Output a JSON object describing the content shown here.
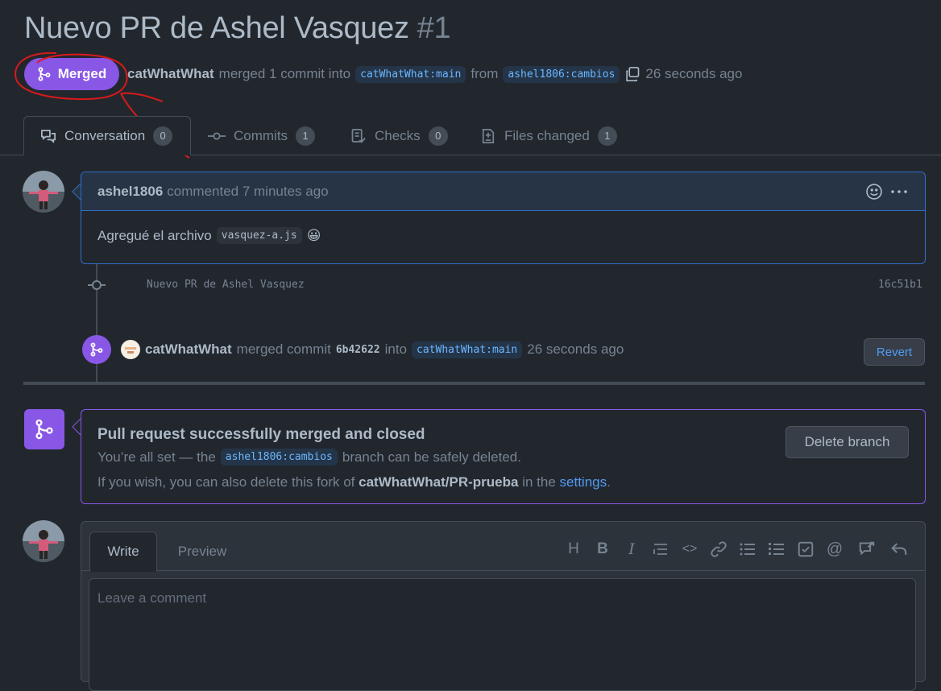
{
  "pr": {
    "title": "Nuevo PR de Ashel Vasquez",
    "number": "#1",
    "state": "Merged",
    "author": "catWhatWhat",
    "merge_text": "merged 1 commit into",
    "base_branch": "catWhatWhat:main",
    "from_text": "from",
    "head_branch": "ashel1806:cambios",
    "time": "26 seconds ago"
  },
  "tabs": [
    {
      "label": "Conversation",
      "count": "0"
    },
    {
      "label": "Commits",
      "count": "1"
    },
    {
      "label": "Checks",
      "count": "0"
    },
    {
      "label": "Files changed",
      "count": "1"
    }
  ],
  "comment": {
    "author": "ashel1806",
    "action": "commented 7 minutes ago",
    "body_text": "Agregué el archivo",
    "file": "vasquez-a.js",
    "emoji": "😀"
  },
  "commit": {
    "message": "Nuevo PR de Ashel Vasquez",
    "sha": "16c51b1"
  },
  "merge_event": {
    "user": "catWhatWhat",
    "text": "merged commit",
    "sha": "6b42622",
    "into": "into",
    "branch": "catWhatWhat:main",
    "time": "26 seconds ago",
    "revert_label": "Revert"
  },
  "merged_box": {
    "title": "Pull request successfully merged and closed",
    "line1_pre": "You’re all set — the",
    "branch": "ashel1806:cambios",
    "line1_post": "branch can be safely deleted.",
    "line2_pre": "If you wish, you can also delete this fork of",
    "repo": "catWhatWhat/PR-prueba",
    "line2_mid": "in the",
    "settings_link": "settings",
    "line2_end": ".",
    "delete_label": "Delete branch"
  },
  "editor": {
    "write_tab": "Write",
    "preview_tab": "Preview",
    "placeholder": "Leave a comment",
    "toolbar": [
      "heading-icon",
      "bold-icon",
      "italic-icon",
      "quote-icon",
      "code-icon",
      "link-icon",
      "unordered-list-icon",
      "ordered-list-icon",
      "task-list-icon",
      "mention-icon",
      "reference-icon",
      "reply-icon"
    ],
    "toolbar_glyphs": [
      "H",
      "B",
      "I",
      "",
      "<>",
      "",
      "",
      "",
      "",
      "@",
      "",
      ""
    ]
  },
  "colors": {
    "merged": "#8957e5",
    "annotation": "#d81a1a",
    "link": "#539bf5"
  }
}
